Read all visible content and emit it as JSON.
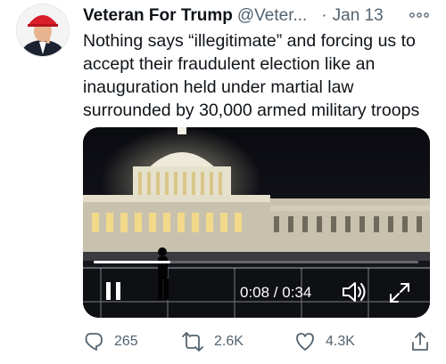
{
  "tweet": {
    "author_name": "Veteran For Trump",
    "handle": "@Veter...",
    "separator": "·",
    "date": "Jan 13",
    "text": "Nothing says “illegitimate” and forcing us to accept their fraudulent election like an inauguration held under martial law surrounded by 30,000 armed military troops"
  },
  "video": {
    "time_display": "0:08 / 0:34",
    "progress": 0.235
  },
  "actions": {
    "reply_count": "265",
    "retweet_count": "2.6K",
    "like_count": "4.3K"
  },
  "colors": {
    "secondary_text": "#536471",
    "video_bg": "#06070b"
  },
  "icons": [
    "more-icon",
    "pause-icon",
    "volume-icon",
    "fullscreen-icon",
    "reply-icon",
    "retweet-icon",
    "like-icon",
    "share-icon"
  ]
}
